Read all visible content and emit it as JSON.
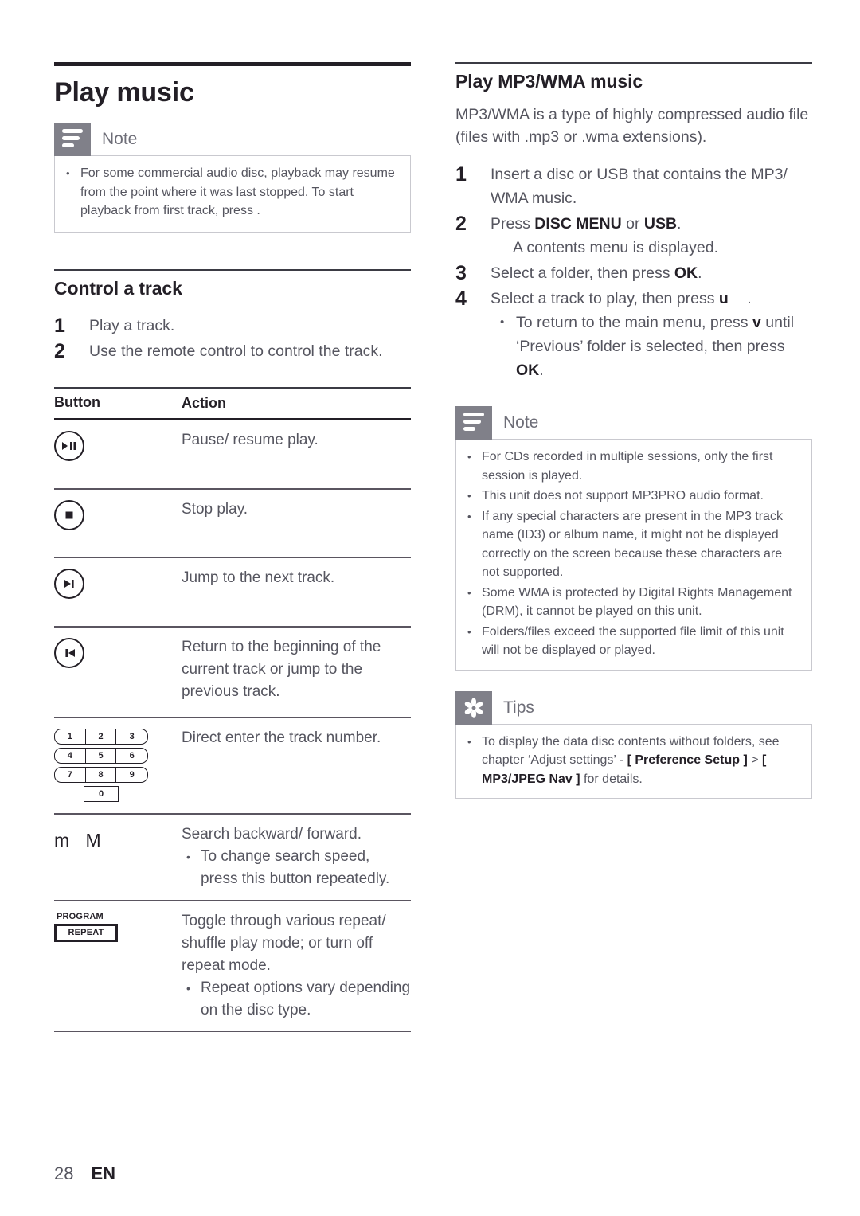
{
  "document": {
    "chapter_title": "Play music",
    "footer": {
      "page_number": "28",
      "language": "EN"
    }
  },
  "left_column": {
    "note_box": {
      "title": "Note",
      "icon": "note-lines-icon",
      "bullets": [
        "For some commercial audio disc, playback may resume from the point where it was last stopped. To start playback from first track, press  ."
      ]
    },
    "section": {
      "title": "Control a track",
      "steps": [
        {
          "num": "1",
          "text": "Play a track."
        },
        {
          "num": "2",
          "text": "Use the remote control to control the track."
        }
      ]
    },
    "table": {
      "headers": {
        "button": "Button",
        "action": "Action"
      },
      "rows": [
        {
          "button_icon": "play-pause-button-icon",
          "action": "Pause/ resume play.",
          "sub_bullets": []
        },
        {
          "button_icon": "stop-button-icon",
          "action": "Stop play.",
          "sub_bullets": []
        },
        {
          "button_icon": "next-track-button-icon",
          "action": "Jump to the next track.",
          "sub_bullets": []
        },
        {
          "button_icon": "previous-track-button-icon",
          "action": "Return to the beginning of the current track or jump to the previous track.",
          "sub_bullets": []
        },
        {
          "button_icon": "numeric-keypad-icon",
          "keypad": {
            "row1": [
              "1",
              "2",
              "3"
            ],
            "row2": [
              "4",
              "5",
              "6"
            ],
            "row3": [
              "7",
              "8",
              "9"
            ],
            "zero": "0"
          },
          "action": "Direct enter the track number.",
          "sub_bullets": []
        },
        {
          "button_icon": "search-backward-forward-icon",
          "glyphs": "m  M",
          "action": "Search backward/ forward.",
          "sub_bullets": [
            "To change search speed, press this button repeatedly."
          ]
        },
        {
          "button_icon": "program-repeat-button-icon",
          "program_label": "PROGRAM",
          "repeat_label": "REPEAT",
          "action": "Toggle through various repeat/ shuffle play mode; or turn off repeat mode.",
          "sub_bullets": [
            "Repeat options vary depending on the disc type."
          ]
        }
      ]
    }
  },
  "right_column": {
    "section": {
      "title": "Play MP3/WMA music",
      "intro": "MP3/WMA is a type of highly compressed audio file (files with .mp3 or .wma extensions)."
    },
    "steps": [
      {
        "num": "1",
        "text": "Insert a disc or USB that contains the MP3/ WMA music."
      },
      {
        "num": "2",
        "text_pre": "Press ",
        "bold1": "DISC MENU",
        "text_mid": " or ",
        "bold2": "USB",
        "text_post": ".",
        "note": "A contents menu is displayed."
      },
      {
        "num": "3",
        "text_pre": "Select a folder, then press ",
        "bold1": "OK",
        "text_post": "."
      },
      {
        "num": "4",
        "text_pre": "Select a track to play, then press ",
        "bold1": "u",
        "text_post": " ."
      }
    ],
    "step4_bullet": {
      "pre": "To return to the main menu, press ",
      "bold1": "v",
      "mid": " until ‘Previous’ folder is selected, then press ",
      "bold2": "OK",
      "post": "."
    },
    "note_box": {
      "title": "Note",
      "icon": "note-lines-icon",
      "bullets": [
        "For CDs recorded in multiple sessions, only the first session is played.",
        "This unit does not support MP3PRO audio format.",
        "If any special characters are present in the MP3 track name (ID3) or album name, it might not be displayed correctly on the screen because these characters are not supported.",
        "Some WMA is protected by Digital Rights Management (DRM), it cannot be played on this unit.",
        "Folders/files exceed the supported file limit of this unit will not be displayed or played."
      ]
    },
    "tips_box": {
      "title": "Tips",
      "icon": "asterisk-icon",
      "bullet": {
        "pre": "To display the data disc contents without folders, see chapter ‘Adjust settings’ - ",
        "bold1": "[ Preference Setup ]",
        "mid": " > ",
        "bold2": "[ MP3/JPEG Nav ]",
        "post": " for details."
      }
    }
  },
  "colors": {
    "accent_gray": "#808089",
    "text": "#55555f",
    "heading": "#231f26",
    "box_border": "#c9c9cf"
  }
}
